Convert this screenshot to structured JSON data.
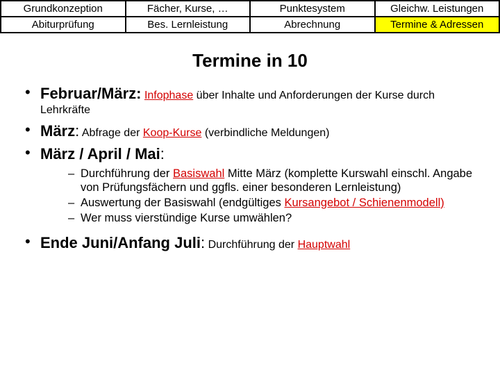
{
  "tabs": {
    "r0c0": "Grundkonzeption",
    "r0c1": "Fächer, Kurse, …",
    "r0c2": "Punktesystem",
    "r0c3": "Gleichw. Leistungen",
    "r1c0": "Abiturprüfung",
    "r1c1": "Bes. Lernleistung",
    "r1c2": "Abrechnung",
    "r1c3": "Termine & Adressen"
  },
  "title": "Termine in 10",
  "items": {
    "i0": {
      "lead": "Februar/März:",
      "body_a": "Infophase",
      "body_b": " über Inhalte und Anforderungen der Kurse durch Lehrkräfte"
    },
    "i1": {
      "lead": "März",
      "body_a": "Abfrage der ",
      "body_b": "Koop-Kurse",
      "body_c": " (verbindliche Meldungen)"
    },
    "i2": {
      "lead": "März / April / Mai",
      "sub": {
        "s0_a": "Durchführung der ",
        "s0_b": "Basiswahl",
        "s0_c": " Mitte März (komplette Kurswahl einschl. Angabe von Prüfungsfächern und ggfls. einer besonderen Lernleistung)",
        "s1_a": "Auswertung der Basiswahl (endgültiges ",
        "s1_b": "Kursangebot / Schienenmodell)",
        "s2": "Wer muss vierstündige Kurse umwählen?"
      }
    },
    "i3": {
      "lead": "Ende Juni/Anfang Juli",
      "body_a": "Durchführung der ",
      "body_b": "Hauptwahl"
    }
  }
}
